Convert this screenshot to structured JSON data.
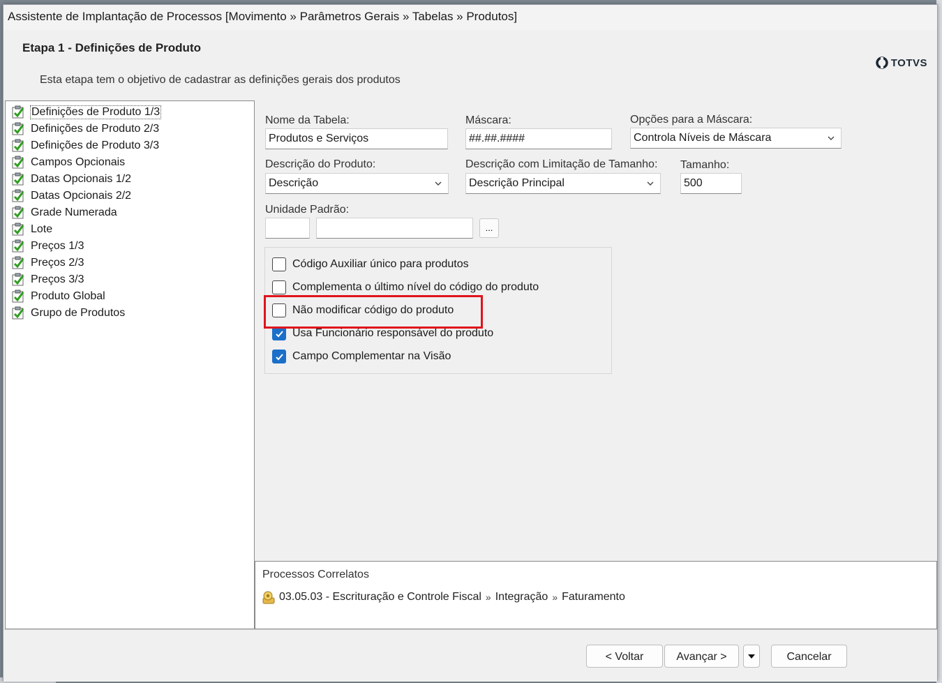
{
  "window": {
    "title": "Assistente de Implantação de Processos [Movimento » Parâmetros Gerais » Tabelas » Produtos]"
  },
  "header": {
    "step_title": "Etapa 1 - Definições de Produto",
    "step_description": "Esta etapa tem o objetivo de cadastrar as definições gerais dos produtos",
    "logo_text": "TOTVS"
  },
  "steps": [
    {
      "label": "Definições de Produto 1/3",
      "checked": true,
      "selected": true
    },
    {
      "label": "Definições de Produto 2/3",
      "checked": true
    },
    {
      "label": "Definições de Produto 3/3",
      "checked": true
    },
    {
      "label": "Campos Opcionais",
      "checked": true
    },
    {
      "label": "Datas Opcionais 1/2",
      "checked": true
    },
    {
      "label": "Datas Opcionais 2/2",
      "checked": true
    },
    {
      "label": "Grade Numerada",
      "checked": true
    },
    {
      "label": "Lote",
      "checked": true
    },
    {
      "label": "Preços 1/3",
      "checked": true
    },
    {
      "label": "Preços 2/3",
      "checked": true
    },
    {
      "label": "Preços 3/3",
      "checked": true
    },
    {
      "label": "Produto Global",
      "checked": true
    },
    {
      "label": "Grupo de Produtos",
      "checked": true
    }
  ],
  "form": {
    "table_name": {
      "label": "Nome da Tabela:",
      "value": "Produtos e Serviços"
    },
    "mask": {
      "label": "Máscara:",
      "value": "##.##.####"
    },
    "mask_options": {
      "label": "Opções para a Máscara:",
      "value": "Controla Níveis de Máscara"
    },
    "product_description": {
      "label": "Descrição do Produto:",
      "value": "Descrição"
    },
    "limited_description": {
      "label": "Descrição com Limitação de Tamanho:",
      "value": "Descrição Principal"
    },
    "size": {
      "label": "Tamanho:",
      "value": "500"
    },
    "default_unit": {
      "label": "Unidade Padrão:",
      "code": "",
      "name": "",
      "lookup_label": "..."
    },
    "options": [
      {
        "label": "Código Auxiliar único para produtos",
        "checked": false
      },
      {
        "label": "Complementa o último nível do código do produto",
        "checked": false
      },
      {
        "label": "Não modificar código do produto",
        "checked": false,
        "highlighted": true
      },
      {
        "label": "Usa Funcionário responsável do produto",
        "checked": true
      },
      {
        "label": "Campo Complementar na Visão",
        "checked": true
      }
    ]
  },
  "related": {
    "title": "Processos Correlatos",
    "path": [
      "03.05.03 - Escrituração e Controle Fiscal",
      "Integração",
      "Faturamento"
    ],
    "separator": "»"
  },
  "buttons": {
    "back": "< Voltar",
    "next": "Avançar >",
    "cancel": "Cancelar"
  },
  "colors": {
    "accent": "#1a6fc9",
    "highlight": "#e0141c",
    "check_green": "#2f9e20"
  }
}
